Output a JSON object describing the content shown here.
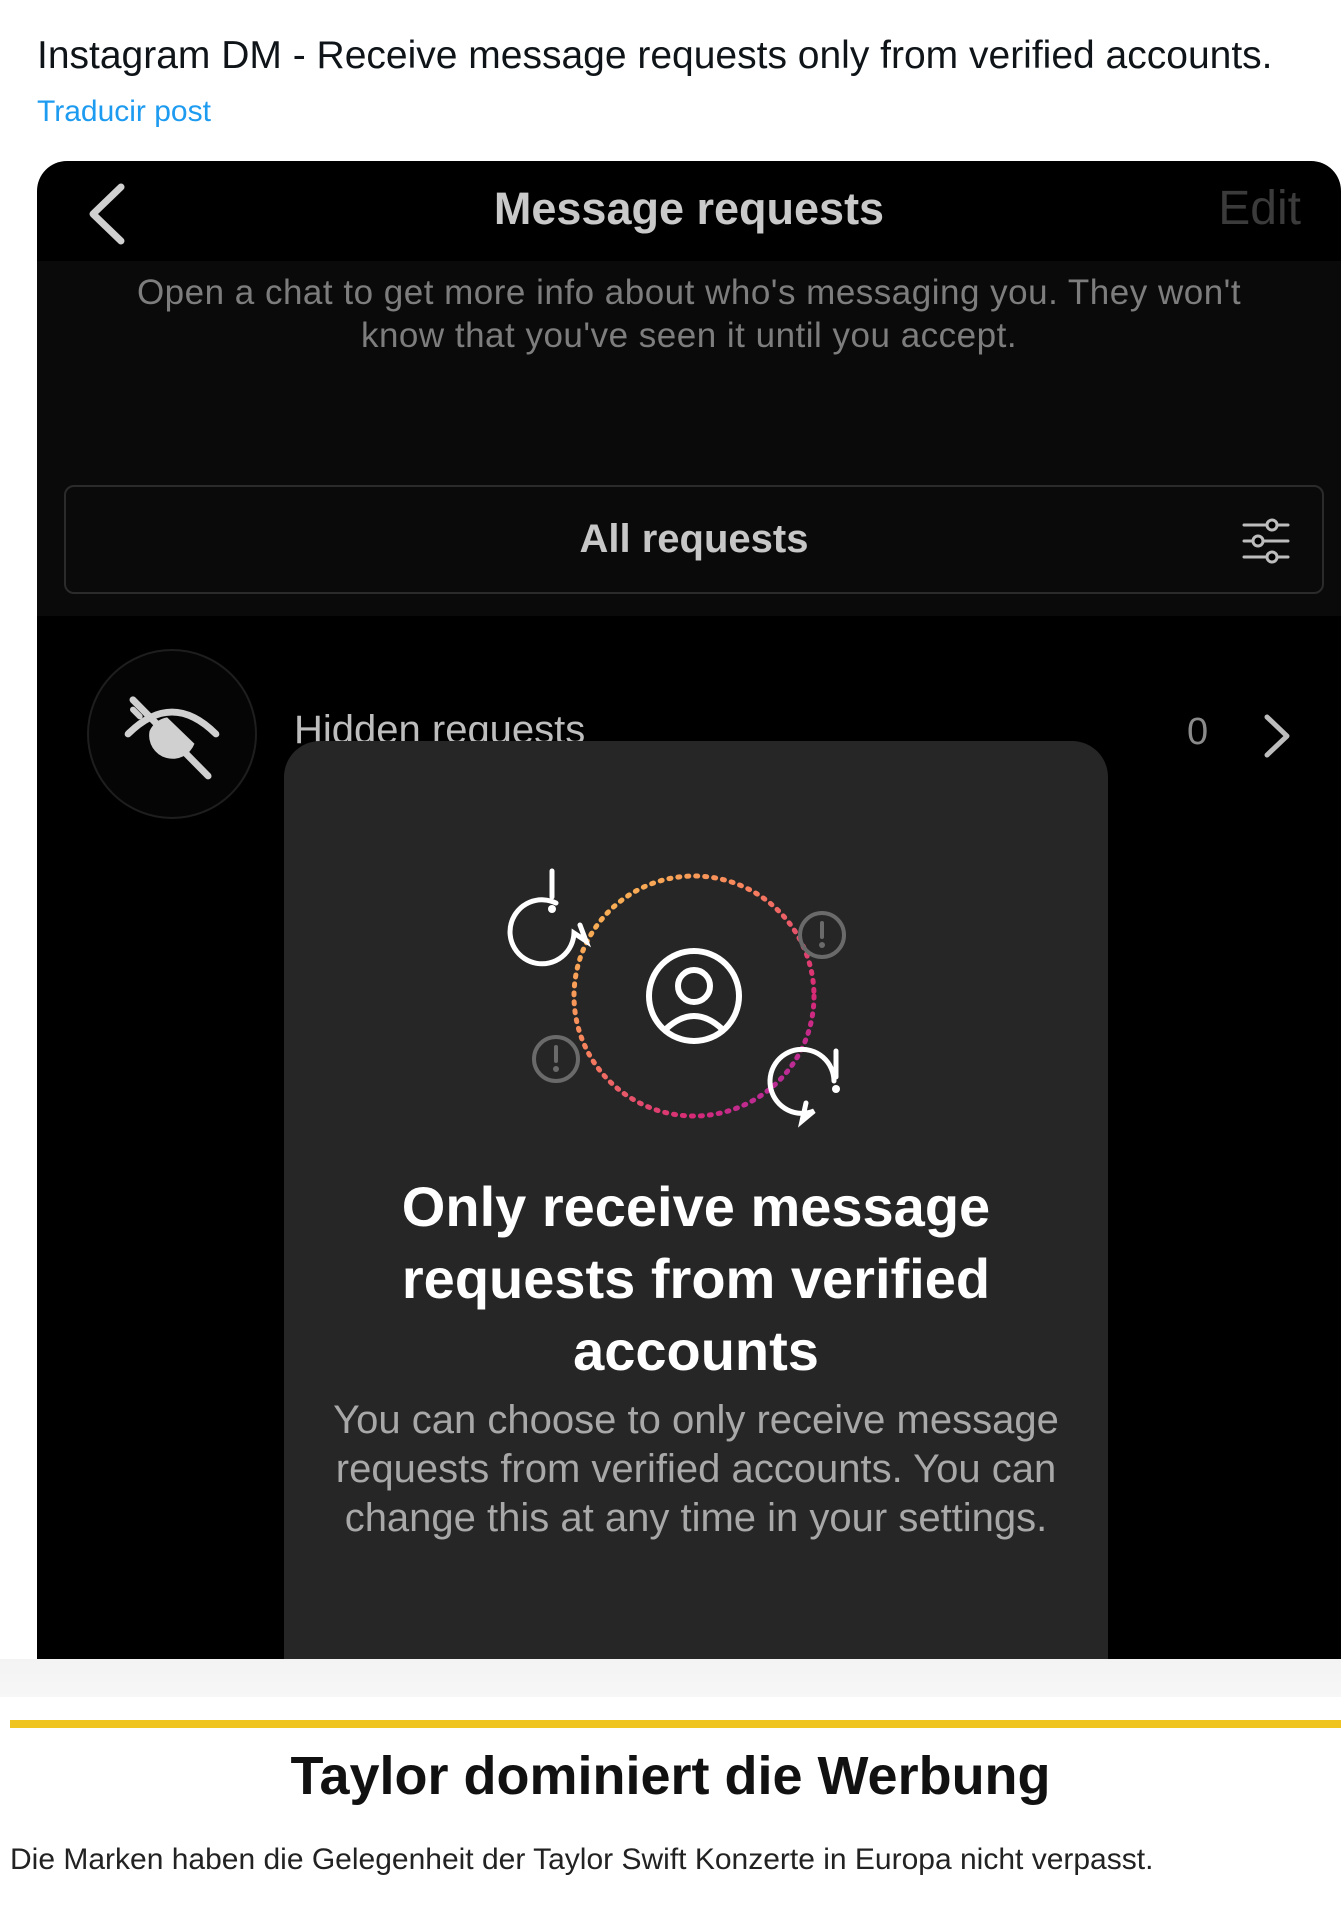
{
  "post": {
    "text": "Instagram DM - Receive message requests only from verified accounts.",
    "translate_label": "Traducir post"
  },
  "screen": {
    "header": {
      "title": "Message requests",
      "edit_label": "Edit",
      "back_icon": "chevron-left-icon"
    },
    "info_text": "Open a chat to get more info about who's messaging you. They won't know that you've seen it until you accept.",
    "filter": {
      "label": "All requests",
      "icon": "sliders-icon"
    },
    "hidden_requests": {
      "label": "Hidden requests",
      "count": "0",
      "icon": "eye-off-icon"
    },
    "sheet": {
      "title": "Only receive message requests from verified accounts",
      "body": "You can choose to only receive message requests from verified accounts. You can change this at any time in your settings.",
      "icons": [
        "alert-bubble-icon",
        "user-circle-icon"
      ]
    }
  },
  "article": {
    "headline": "Taylor dominiert die Werbung",
    "subhead": "Die Marken haben die Gelegenheit der Taylor Swift Konzerte in Europa nicht verpasst."
  },
  "colors": {
    "link": "#1d9bf0",
    "accent_divider": "#f0c420",
    "sheet_background": "#262626",
    "ring_gradient": [
      "#f9c74f",
      "#f77f5e",
      "#d62976",
      "#962fbf"
    ]
  }
}
